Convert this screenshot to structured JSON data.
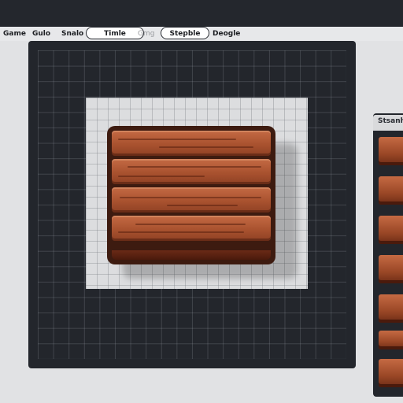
{
  "menu": {
    "items": [
      "Game",
      "Gulo",
      "Snalo"
    ],
    "tabs": [
      "Timle",
      "Gmg",
      "Stepble",
      "Deogle"
    ],
    "selected_tabs": [
      "Timle",
      "Stepble"
    ]
  },
  "canvas": {
    "asset": "wood-plank-tile",
    "plank_count": 4
  },
  "side_panel": {
    "title": "Stsanhl",
    "thumbnail_count": 7
  },
  "colors": {
    "background": "#e1e2e4",
    "panel_dark": "#23262c",
    "wood": "#a9522f",
    "wood_dark": "#3d1b10"
  }
}
